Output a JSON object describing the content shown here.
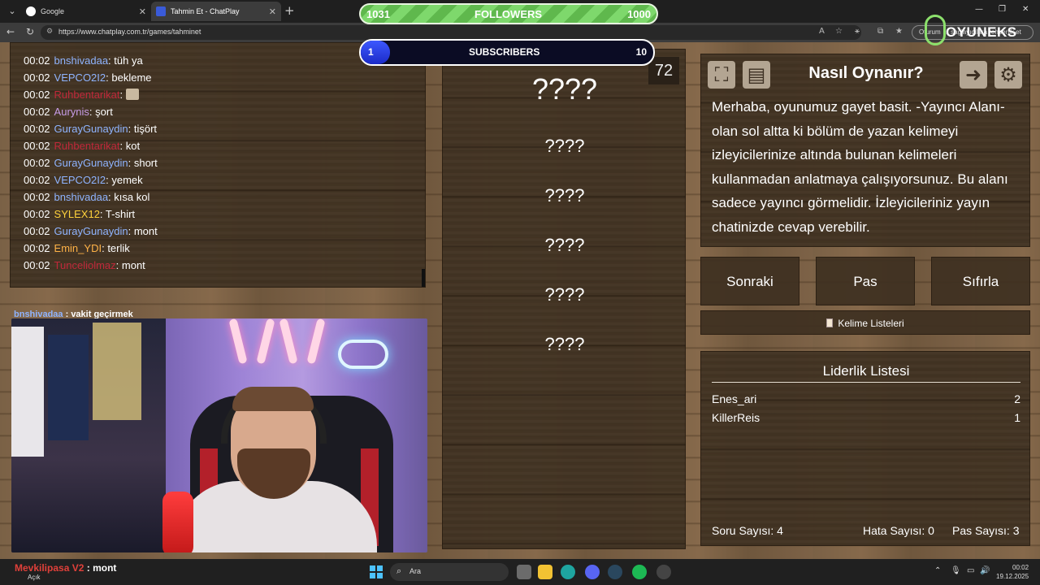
{
  "browser": {
    "tabs": [
      {
        "label": "Google",
        "favicon_color": "#ffffff"
      },
      {
        "label": "Tahmin Et - ChatPlay",
        "favicon_color": "#3a5bd9"
      }
    ],
    "url": "https://www.chatplay.com.tr/games/tahminet",
    "profile_label": "Oturum … sağlayıcılara rehberlik et"
  },
  "overlay": {
    "followers": {
      "current": "1031",
      "label": "FOLLOWERS",
      "goal": "1000"
    },
    "subscribers": {
      "current": "1",
      "label": "SUBSCRIBERS",
      "goal": "10",
      "progress": 0.1
    },
    "brand": "OYUNEKS"
  },
  "chat": {
    "messages": [
      {
        "time": "00:02",
        "user": "bnshivadaa",
        "color": "#8fb4ff",
        "text": "tüh ya"
      },
      {
        "time": "00:02",
        "user": "VEPCO2I2",
        "color": "#8fb4ff",
        "text": "bekleme"
      },
      {
        "time": "00:02",
        "user": "Ruhbentarikat",
        "color": "#c0283a",
        "text": "",
        "emote": true
      },
      {
        "time": "00:02",
        "user": "Aurynis",
        "color": "#c89de8",
        "text": "şort"
      },
      {
        "time": "00:02",
        "user": "GurayGunaydin",
        "color": "#8fb4ff",
        "text": "tişört"
      },
      {
        "time": "00:02",
        "user": "Ruhbentarikat",
        "color": "#c0283a",
        "text": "kot"
      },
      {
        "time": "00:02",
        "user": "GurayGunaydin",
        "color": "#8fb4ff",
        "text": "short"
      },
      {
        "time": "00:02",
        "user": "VEPCO2I2",
        "color": "#8fb4ff",
        "text": "yemek"
      },
      {
        "time": "00:02",
        "user": "bnshivadaa",
        "color": "#8fb4ff",
        "text": "kısa kol"
      },
      {
        "time": "00:02",
        "user": "SYLEX12",
        "color": "#ffd23c",
        "text": "T-shirt"
      },
      {
        "time": "00:02",
        "user": "GurayGunaydin",
        "color": "#8fb4ff",
        "text": "mont"
      },
      {
        "time": "00:02",
        "user": "Emin_YDI",
        "color": "#ffb347",
        "text": "terlik"
      },
      {
        "time": "00:02",
        "user": "Tunceliolmaz",
        "color": "#c0283a",
        "text": "mont"
      }
    ]
  },
  "webcam": {
    "overlay_user": "bnshivadaa",
    "overlay_text": "vakit geçirmek"
  },
  "game": {
    "timer": "72",
    "main_word": "????",
    "forbidden_words": [
      "????",
      "????",
      "????",
      "????",
      "????"
    ]
  },
  "howto": {
    "title": "Nasıl Oynanır?",
    "text": "Merhaba, oyunumuz gayet basit. -Yayıncı Alanı- olan sol altta ki bölüm de yazan kelimeyi izleyicilerinize altında bulunan kelimeleri kullanmadan anlatmaya çalışıyorsunuz. Bu alanı sadece yayıncı görmelidir. İzleyicileriniz yayın chatinizde cevap verebilir."
  },
  "actions": {
    "next": "Sonraki",
    "pass": "Pas",
    "reset": "Sıfırla",
    "word_lists": "Kelime Listeleri"
  },
  "leaderboard": {
    "title": "Liderlik Listesi",
    "rows": [
      {
        "name": "Enes_ari",
        "score": "2"
      },
      {
        "name": "KillerReis",
        "score": "1"
      }
    ],
    "question_count": "Soru Sayısı: 4",
    "error_count": "Hata Sayısı: 0",
    "pass_count": "Pas Sayısı: 3"
  },
  "bottom_overlay": {
    "user": "Mevkilipasa V2",
    "text": "mont",
    "sub": "Açık"
  },
  "taskbar": {
    "search_placeholder": "Ara",
    "time": "00:02",
    "date": "19.12.2025"
  }
}
